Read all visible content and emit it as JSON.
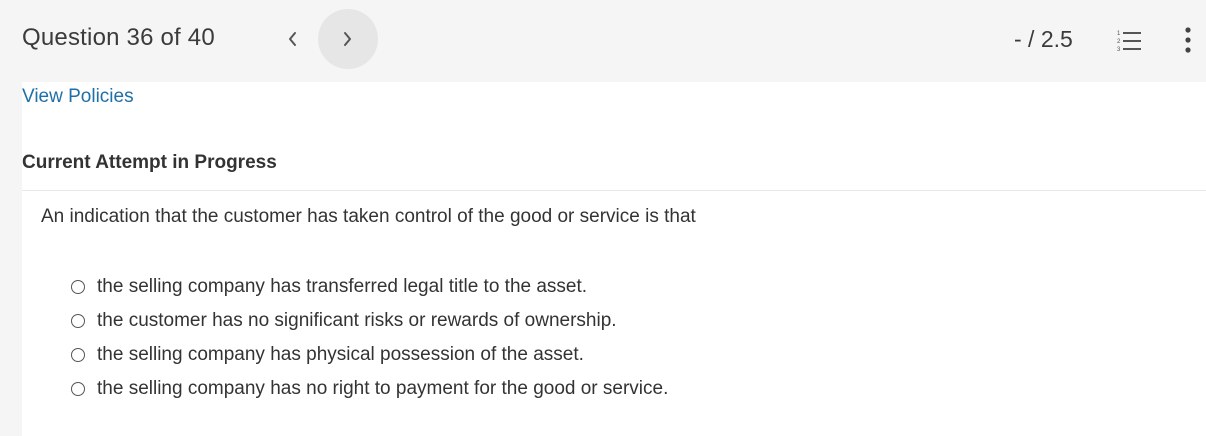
{
  "header": {
    "question_label": "Question 36 of 40",
    "prev_icon": "chevron-left-icon",
    "next_icon": "chevron-right-icon",
    "score": "- / 2.5",
    "list_icon": "numbered-list-icon",
    "more_icon": "vertical-ellipsis-icon"
  },
  "content": {
    "view_policies": "View Policies",
    "attempt_label": "Current Attempt in Progress",
    "question_text": "An indication that the customer has taken control of the good or service is that",
    "options": [
      "the selling company has transferred legal title to the asset.",
      "the customer has no significant risks or rewards of ownership.",
      "the selling company has physical possession of the asset.",
      "the selling company has no right to payment for the good or service."
    ]
  },
  "colors": {
    "link": "#1f6fa8",
    "header_bg": "#f5f5f5",
    "active_nav_bg": "#e6e6e6"
  }
}
